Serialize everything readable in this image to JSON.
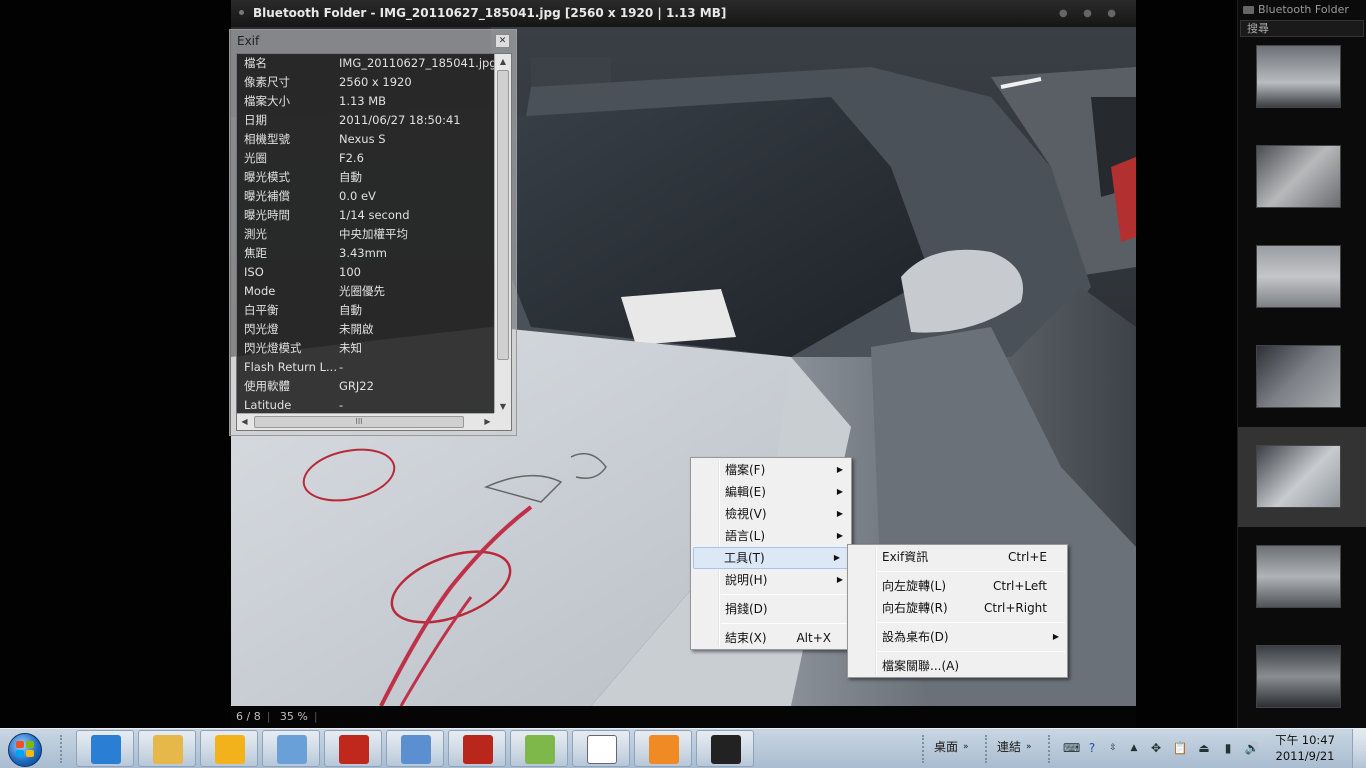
{
  "viewer": {
    "title": "Bluetooth Folder - IMG_20110627_185041.jpg   [2560 x 1920   |   1.13 MB]",
    "status_index": "6 / 8",
    "status_zoom": "35 %",
    "status_sep": "|"
  },
  "strip": {
    "folder_label": "Bluetooth Folder",
    "search_placeholder": "搜尋",
    "selected_index": 5,
    "thumbnails": [
      "thumb-1",
      "thumb-2",
      "thumb-3",
      "thumb-4",
      "thumb-5",
      "thumb-6",
      "thumb-7"
    ]
  },
  "exif": {
    "title": "Exif",
    "close": "✕",
    "hscroll_grip": "III",
    "rows": [
      {
        "k": "檔名",
        "v": "IMG_20110627_185041.jpg"
      },
      {
        "k": "像素尺寸",
        "v": "2560 x 1920"
      },
      {
        "k": "檔案大小",
        "v": "1.13 MB"
      },
      {
        "k": "日期",
        "v": "2011/06/27 18:50:41"
      },
      {
        "k": "相機型號",
        "v": "Nexus S"
      },
      {
        "k": "光圈",
        "v": "F2.6"
      },
      {
        "k": "曝光模式",
        "v": "自動"
      },
      {
        "k": "曝光補償",
        "v": "0.0 eV"
      },
      {
        "k": "曝光時間",
        "v": "1/14 second"
      },
      {
        "k": "測光",
        "v": "中央加權平均"
      },
      {
        "k": "焦距",
        "v": "3.43mm"
      },
      {
        "k": "ISO",
        "v": "100"
      },
      {
        "k": "Mode",
        "v": "光圈優先"
      },
      {
        "k": "白平衡",
        "v": "自動"
      },
      {
        "k": "閃光燈",
        "v": "未開啟"
      },
      {
        "k": "閃光燈模式",
        "v": "未知"
      },
      {
        "k": "Flash Return L...",
        "v": "-"
      },
      {
        "k": "使用軟體",
        "v": "GRJ22"
      },
      {
        "k": "Latitude",
        "v": "-"
      }
    ]
  },
  "context_menu": {
    "items": [
      {
        "label": "檔案(F)",
        "submenu": true
      },
      {
        "label": "編輯(E)",
        "submenu": true
      },
      {
        "label": "檢視(V)",
        "submenu": true
      },
      {
        "label": "語言(L)",
        "submenu": true
      },
      {
        "label": "工具(T)",
        "submenu": true,
        "highlight": true
      },
      {
        "label": "說明(H)",
        "submenu": true
      },
      {
        "label": "捐錢(D)",
        "submenu": false
      },
      {
        "label": "結束(X)",
        "shortcut": "Alt+X"
      }
    ]
  },
  "tools_submenu": {
    "items": [
      {
        "label": "Exif資訊",
        "shortcut": "Ctrl+E"
      },
      {
        "label": "向左旋轉(L)",
        "shortcut": "Ctrl+Left"
      },
      {
        "label": "向右旋轉(R)",
        "shortcut": "Ctrl+Right"
      },
      {
        "label": "設為桌布(D)",
        "submenu": true
      },
      {
        "label": "檔案關聯...(A)"
      }
    ]
  },
  "taskbar": {
    "toolbar_desktop": "桌面",
    "toolbar_links": "連結",
    "clock_time": "下午 10:47",
    "clock_date": "2011/9/21",
    "apps": [
      {
        "name": "ie-icon",
        "color": "#2a7fd4"
      },
      {
        "name": "explorer-icon",
        "color": "#e6b84a"
      },
      {
        "name": "weather-icon",
        "color": "#f2b21c"
      },
      {
        "name": "magnifier-icon",
        "color": "#6aa0d8"
      },
      {
        "name": "media-app-icon",
        "color": "#c0281e"
      },
      {
        "name": "chrome-icon",
        "color": "#5a8fd0"
      },
      {
        "name": "filezilla-icon",
        "color": "#b8261c"
      },
      {
        "name": "notepadpp-icon",
        "color": "#7fb84a"
      },
      {
        "name": "document-icon",
        "color": "#ffffff"
      },
      {
        "name": "virtualbox-icon",
        "color": "#f08a24"
      },
      {
        "name": "image-viewer-icon",
        "color": "#222222"
      }
    ]
  }
}
